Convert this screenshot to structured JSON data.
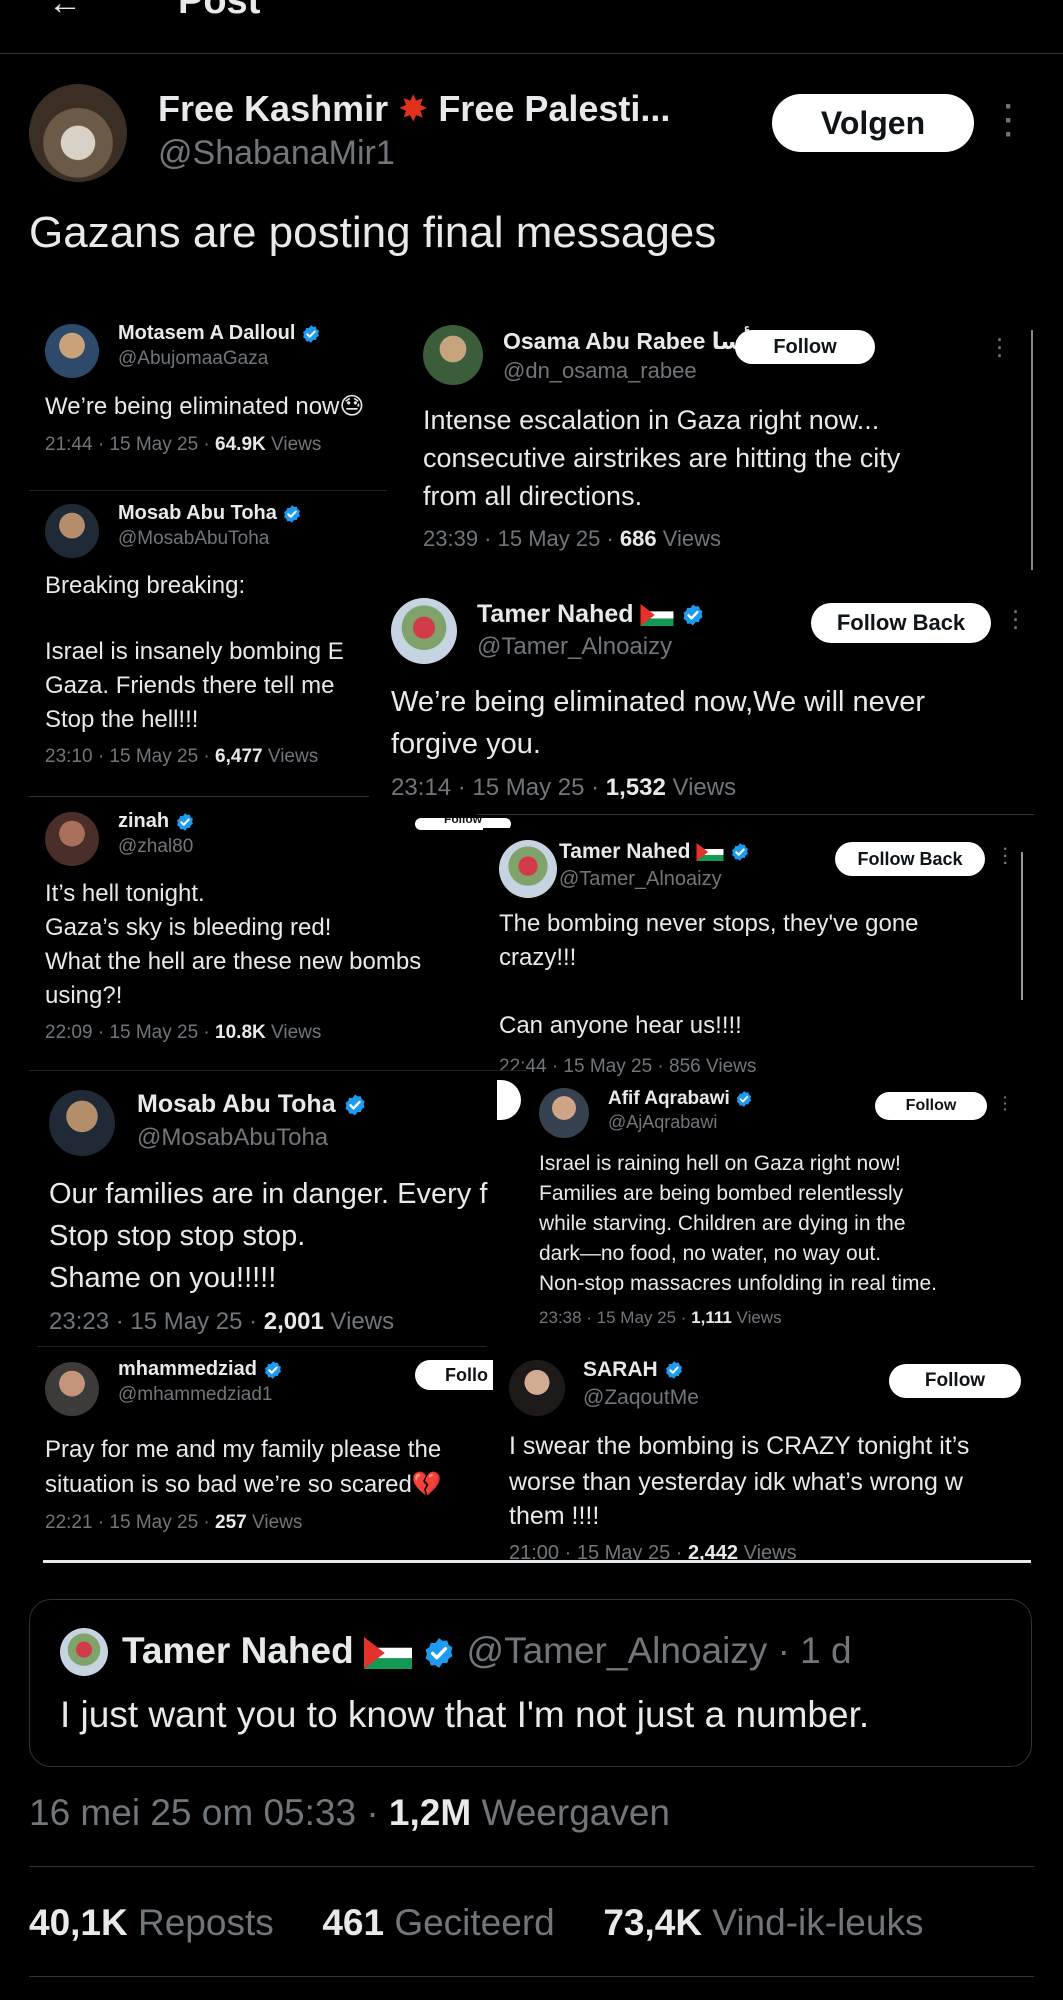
{
  "header": {
    "title": "Post"
  },
  "post": {
    "author_name": "Free Kashmir",
    "author_name_2": "Free Palesti...",
    "author_handle": "@ShabanaMir1",
    "follow_label": "Volgen",
    "text": "Gazans are posting final messages"
  },
  "collage": {
    "t1": {
      "name": "Motasem A Dalloul",
      "handle": "@AbujomaaGaza",
      "text": "We’re being eliminated now",
      "time": "21:44 · 15 May 25 · ",
      "count": "64.9K",
      "views": " Views"
    },
    "t2": {
      "name": "Osama Abu Rabee أسا...",
      "handle": "@dn_osama_rabee",
      "follow": "Follow",
      "line1": "Intense escalation in Gaza right now...",
      "line2": "consecutive airstrikes are hitting the city",
      "line3": "from all directions.",
      "time": "23:39 · 15 May 25 · ",
      "count": "686",
      "views": " Views"
    },
    "t3": {
      "name": "Mosab Abu Toha",
      "handle": "@MosabAbuToha",
      "line1": "Breaking breaking:",
      "line2": "Israel is insanely bombing E",
      "line3": "Gaza. Friends there tell me",
      "line4": "Stop the hell!!!",
      "time": "23:10 · 15 May 25 · ",
      "count": "6,477",
      "views": " Views"
    },
    "t4": {
      "name": "Tamer Nahed",
      "handle": "@Tamer_Alnoaizy",
      "follow": "Follow Back",
      "line1": "We’re being eliminated now,We will never",
      "line2": "forgive you.",
      "time": "23:14 · 15 May 25 · ",
      "count": "1,532",
      "views": " Views"
    },
    "t5": {
      "name": "zinah",
      "handle": "@zhal80",
      "line1": "It’s hell tonight.",
      "line2": "Gaza’s sky is bleeding red!",
      "line3": "What the hell are these new bombs",
      "line4": "using?!",
      "time": "22:09 · 15 May 25 · ",
      "count": "10.8K",
      "views": " Views"
    },
    "t6": {
      "name": "Tamer Nahed",
      "handle": "@Tamer_Alnoaizy",
      "follow": "Follow Back",
      "line1": "The bombing never stops, they've gone",
      "line2": "crazy!!!",
      "line3": "Can anyone hear us!!!!",
      "time": "22:44 · 15 May 25 · 856 Views"
    },
    "t7": {
      "name": "Mosab Abu Toha",
      "handle": "@MosabAbuToha",
      "line1": "Our families are in danger. Every f",
      "line2": "Stop stop stop stop.",
      "line3": "Shame on you!!!!!",
      "time": "23:23 · 15 May 25 · ",
      "count": "2,001",
      "views": " Views"
    },
    "t8": {
      "name": "Afif Aqrabawi",
      "handle": "@AjAqrabawi",
      "follow": "Follow",
      "line1": "Israel is raining hell on Gaza right now!",
      "line2": "Families are being bombed relentlessly",
      "line3": "while starving. Children are dying in the",
      "line4": "dark—no food, no water, no way out.",
      "line5": "Non-stop massacres unfolding in real time.",
      "time": "23:38 · 15 May 25 · ",
      "count": "1,111",
      "views": " Views"
    },
    "t9": {
      "name": "mhammedziad",
      "handle": "@mhammedziad1",
      "follow": "Follo",
      "line1": "Pray for me and my family please the",
      "line2": "situation is so bad we’re so scared",
      "time": "22:21 · 15 May 25 · ",
      "count": "257",
      "views": " Views"
    },
    "t10": {
      "name": "SARAH",
      "handle": "@ZaqoutMe",
      "follow": "Follow",
      "line1": "I swear the bombing is CRAZY tonight it’s",
      "line2": "worse than yesterday idk what’s wrong w",
      "line3": "them !!!!",
      "time": "21:00 · 15 May 25 · ",
      "count": "2,442",
      "views": " Views"
    },
    "stray_follow": "Follow"
  },
  "quote": {
    "name": "Tamer Nahed",
    "handle": "@Tamer_Alnoaizy · 1 d",
    "text": "I just want you to know that I'm not just a number."
  },
  "meta": {
    "datetime": "16 mei 25 om 05:33 · ",
    "views_count": "1,2M",
    "views_label": " Weergaven"
  },
  "stats": {
    "reposts_count": "40,1K",
    "reposts_label": " Reposts",
    "quotes_count": "461",
    "quotes_label": " Geciteerd",
    "likes_count": "73,4K",
    "likes_label": " Vind-ik-leuks"
  },
  "colors": {
    "verified": "#1d9bf0",
    "background": "#000000",
    "muted": "#71767b"
  }
}
